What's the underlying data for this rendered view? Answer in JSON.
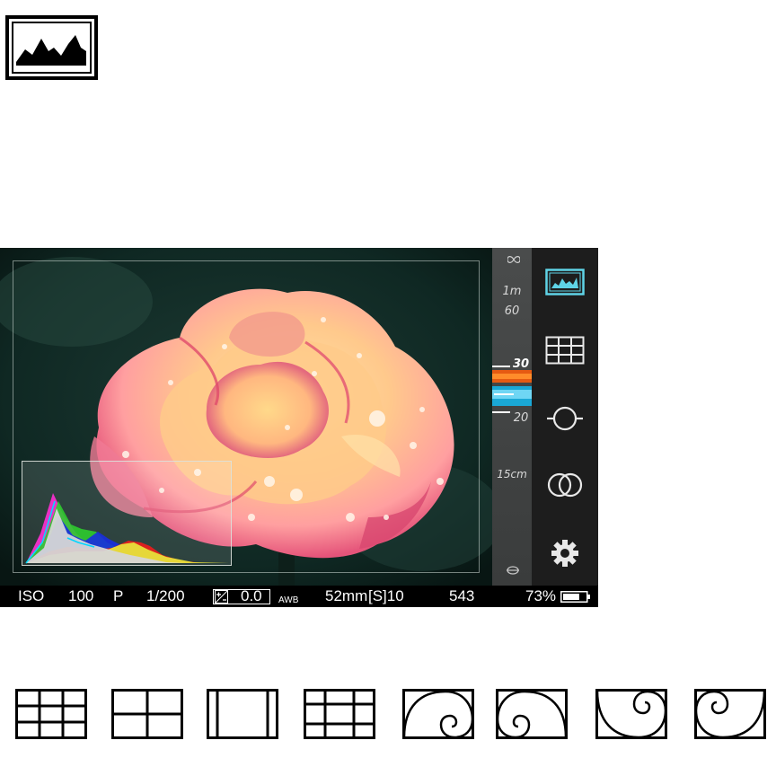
{
  "focus_scale": {
    "labels": [
      "1m",
      "60",
      "30",
      "20",
      "15cm"
    ],
    "infinity_icon": "infinity-icon",
    "macro_icon": "macro-flower-icon"
  },
  "sidebar": {
    "buttons": [
      {
        "name": "histogram",
        "icon": "histogram-icon",
        "active": true
      },
      {
        "name": "grid",
        "icon": "grid-icon",
        "active": false
      },
      {
        "name": "level",
        "icon": "level-icon",
        "active": false
      },
      {
        "name": "filters",
        "icon": "overlapping-circles-icon",
        "active": false
      },
      {
        "name": "settings",
        "icon": "gear-icon",
        "active": false
      }
    ]
  },
  "status_bar": {
    "iso_label": "ISO",
    "iso_value": "100",
    "mode": "P",
    "shutter": "1/200",
    "ev_value": "0.0",
    "wb": "AWB",
    "focal_length": "52",
    "focal_unit": "mm",
    "self_timer": "[S]10",
    "shots_remaining": "543",
    "battery": "73%",
    "battery_level": 0.73
  },
  "overlay_icons": [
    "grid-3x3-icon",
    "grid-2x2-icon",
    "crop-frame-icon",
    "grid-3x3-icon",
    "golden-spiral-icon",
    "golden-spiral-icon",
    "golden-spiral-icon",
    "golden-spiral-icon"
  ],
  "colors": {
    "accent": "#5fd3e6",
    "sidebar_bg": "#1d1d1d",
    "status_bg": "#000000"
  }
}
